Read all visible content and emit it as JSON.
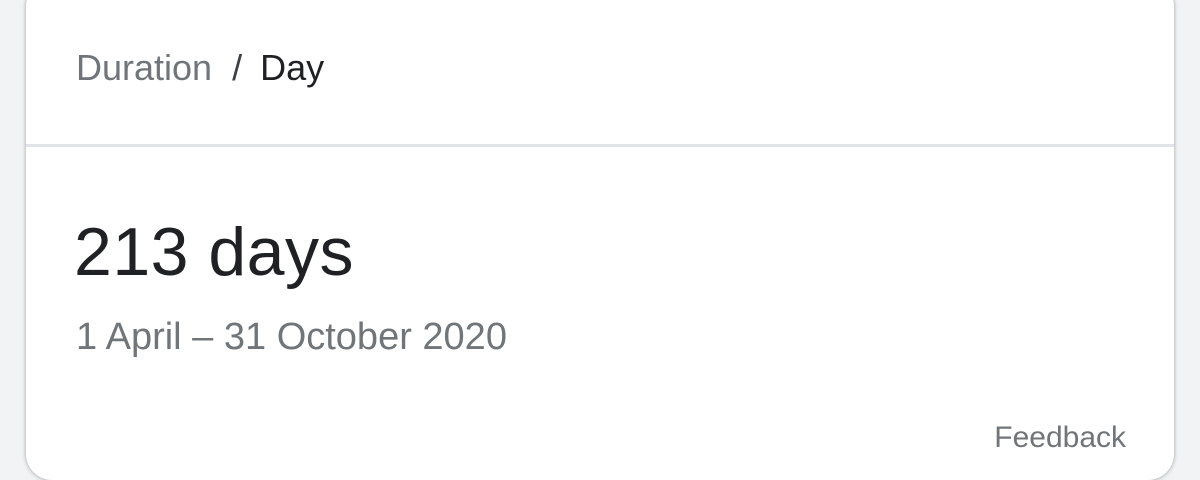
{
  "breadcrumb": {
    "parent": "Duration",
    "separator": "/",
    "current": "Day"
  },
  "result": {
    "value": "213 days",
    "range": "1 April – 31 October 2020"
  },
  "footer": {
    "feedback_label": "Feedback"
  }
}
